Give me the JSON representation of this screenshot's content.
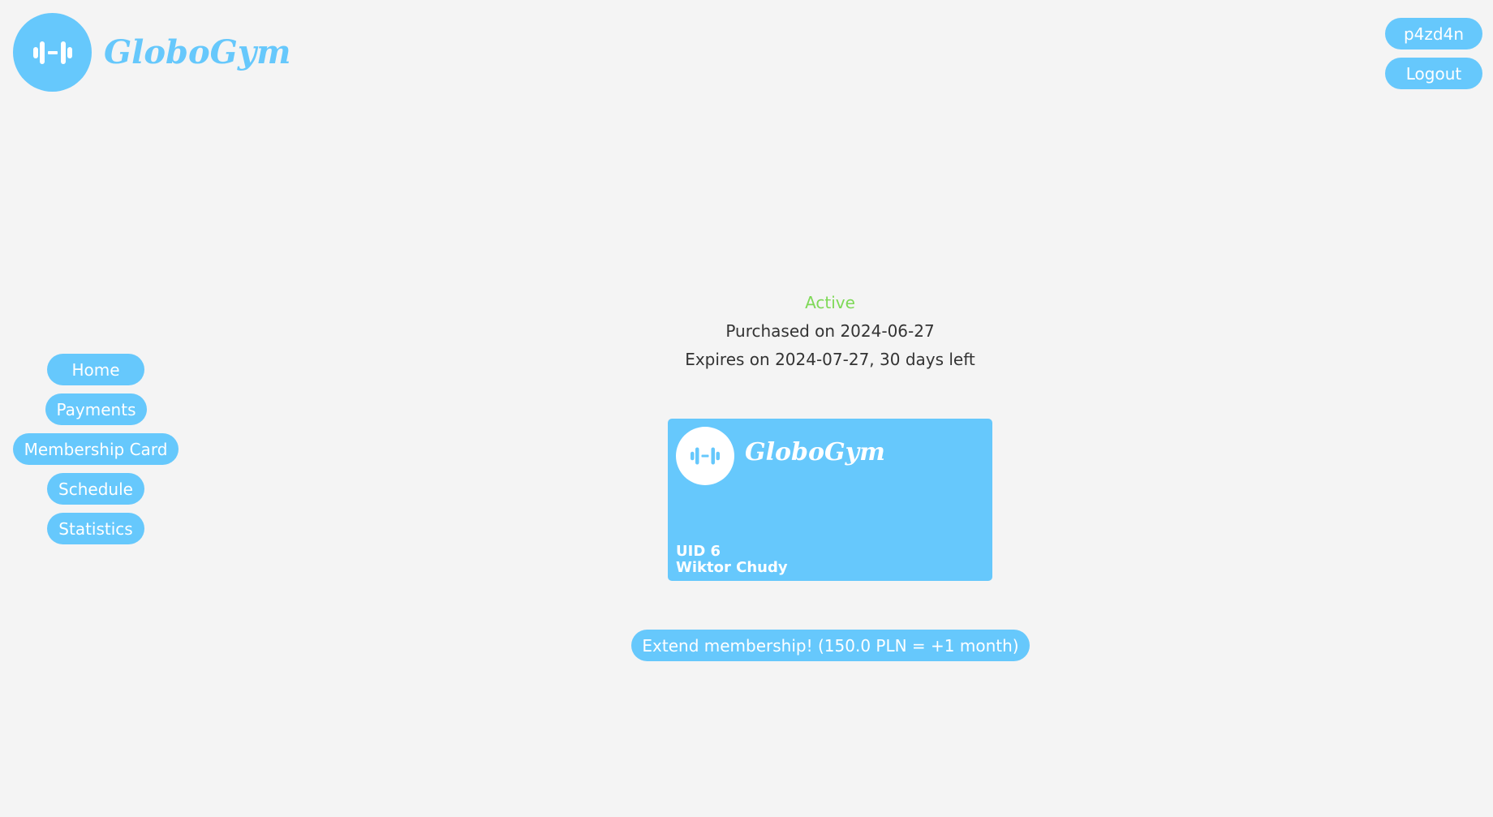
{
  "header": {
    "brand_name": "GloboGym",
    "logo_icon": "dumbbell-icon",
    "username": "p4zd4n",
    "logout_label": "Logout"
  },
  "nav": {
    "items": [
      {
        "label": "Home"
      },
      {
        "label": "Payments"
      },
      {
        "label": "Membership Card"
      },
      {
        "label": "Schedule"
      },
      {
        "label": "Statistics"
      }
    ]
  },
  "membership": {
    "status": "Active",
    "purchased": "Purchased on 2024-06-27",
    "expires": "Expires on 2024-07-27, 30 days left"
  },
  "card": {
    "brand_name": "GloboGym",
    "uid": "UID 6",
    "holder_name": "Wiktor Chudy"
  },
  "extend_label": "Extend membership! (150.0 PLN = +1 month)",
  "colors": {
    "accent": "#66c8fc",
    "active": "#7ed957",
    "background": "#f4f4f4"
  }
}
